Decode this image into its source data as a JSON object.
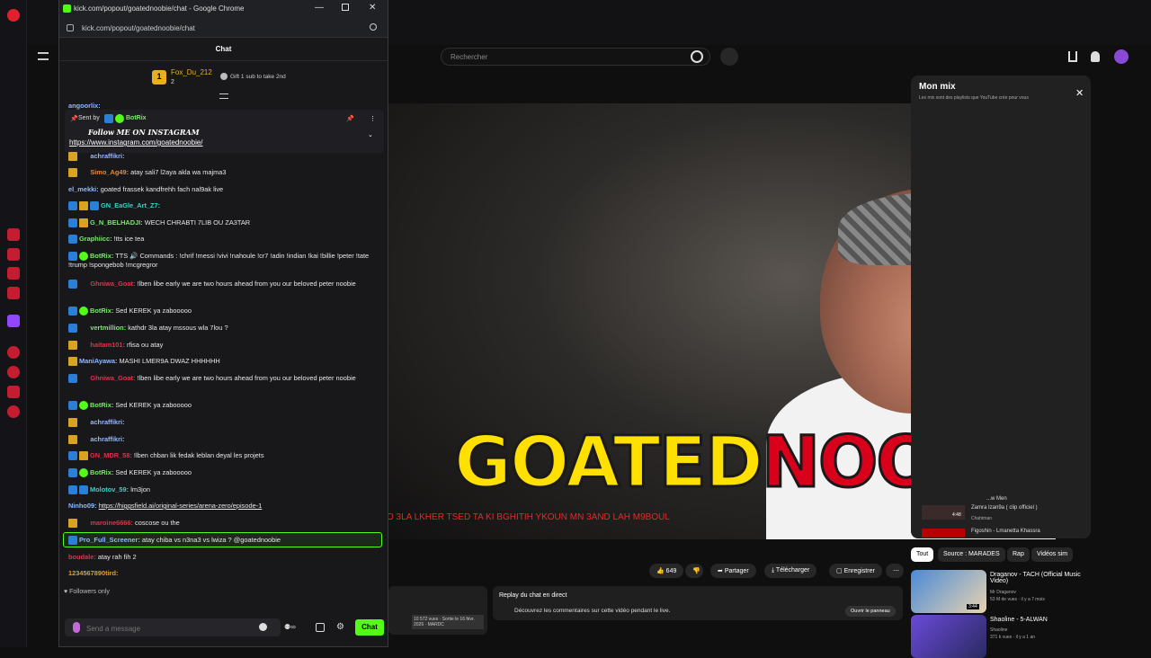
{
  "browser": {
    "popout_title": "kick.com/popout/goatednoobie/chat - Google Chrome",
    "popout_url": "kick.com/popout/goatednoobie/chat"
  },
  "youtube": {
    "search_placeholder": "Rechercher",
    "video_ticker": "O 3LA LKHER TSED TA KI BGHITIH YKOUN MN 3AND LAH M9BOUL",
    "logo_part1": "GOATED",
    "logo_part2": "NOOBIE",
    "mix": {
      "title": "Mon mix",
      "subtitle": "Les mix sont des playlists que YouTube crée pour vous",
      "items": [
        {
          "title": "...w Men",
          "channel": ""
        },
        {
          "title": "Zamra Izan9a ( clip officiel )",
          "channel": "Chahtman",
          "duration": "4:48"
        },
        {
          "title": "Figoshin - Lmanetta Khassra",
          "channel": ""
        }
      ]
    },
    "chips": [
      "Tout",
      "Source : MARADES",
      "Rap",
      "Vidéos sim"
    ],
    "actions": {
      "likes": "649",
      "share": "Partager",
      "download": "Télécharger",
      "save": "Enregistrer"
    },
    "live_chat": {
      "title": "Replay du chat en direct",
      "desc": "Découvrez les commentaires sur cette vidéo pendant le live.",
      "button": "Ouvrir le panneau"
    },
    "views_box": "10 572 vues · Sortie le 16 févr. 2026 · MARDC",
    "recs": [
      {
        "title": "Draganov - TACH (Official Music Video)",
        "channel": "Mr Draganov",
        "meta": "53 M de vues · il y a 7 mois",
        "duration": "3:44"
      },
      {
        "title": "Shaoline - 5-ALWAN",
        "channel": "Shaoline",
        "meta": "371 k vues · il y a 1 an"
      }
    ]
  },
  "chat": {
    "header": "Chat",
    "sub_leader": {
      "name": "Fox_Du_212",
      "rank": "1",
      "count": "2",
      "gift_text": "Gift 1 sub to take 2nd"
    },
    "partial_top_user": "angoorlix:",
    "pinned": {
      "sent_by": "Sent by",
      "author": "BotRix",
      "line1": "Follow ME ON INSTAGRAM",
      "link": "https://www.instagram.com/goatednoobie/"
    },
    "messages": [
      {
        "user": "achraffikri:",
        "text": "",
        "color": "#8fb8ff"
      },
      {
        "user": "Simo_Ag49:",
        "text": "atay sali7 l2aya akla wa majma3",
        "color": "#e08a3c"
      },
      {
        "user": "el_mekki:",
        "text": "goated frassek kandfrehh fach nal9ak live",
        "color": "#8fb8ff"
      },
      {
        "user": "GN_EaGle_Art_Z7:",
        "text": "",
        "color": "#3cd0c8"
      },
      {
        "user": "G_N_BELHADJI:",
        "text": "WECH CHRABTI 7LIB OU ZA3TAR",
        "color": "#7be86c"
      },
      {
        "user": "Graphiicc:",
        "text": "!tts ice tea",
        "color": "#7be86c"
      },
      {
        "user": "BotRix:",
        "text": "TTS 🔊 Commands : !chrif !messi !vivi !nahoule !cr7 !adin !indian !kai !billie !peter !tate !trump !spongebob !mcgregror",
        "color": "#7be86c"
      },
      {
        "user": "Ghniwa_Goat:",
        "text": "!lben libe early we are two hours ahead from you our beloved peter noobie",
        "color": "#d8354a"
      },
      {
        "user": "BotRix:",
        "text": "Sed KEREK ya zabooooo",
        "color": "#7be86c"
      },
      {
        "user": "vertmillion:",
        "text": "kathdr 3la atay mssous wla 7lou ?",
        "color": "#7be86c"
      },
      {
        "user": "haitam101:",
        "text": "rfisa ou atay",
        "color": "#d8354a"
      },
      {
        "user": "ManiAyawa:",
        "text": "MASHI LMER9A DWAZ HHHHHH",
        "color": "#8fb8ff"
      },
      {
        "user": "Ghniwa_Goat:",
        "text": "!lben libe early we are two hours ahead from you our beloved peter noobie",
        "color": "#d8354a"
      },
      {
        "user": "BotRix:",
        "text": "Sed KEREK ya zabooooo",
        "color": "#7be86c"
      },
      {
        "user": "achraffikri:",
        "text": "",
        "color": "#8fb8ff"
      },
      {
        "user": "achraffikri:",
        "text": "",
        "color": "#8fb8ff"
      },
      {
        "user": "GN_MDR_58:",
        "text": "!lben chban lik fedak leblan deyal les projets",
        "color": "#d8354a"
      },
      {
        "user": "BotRix:",
        "text": "Sed KEREK ya zabooooo",
        "color": "#7be86c"
      },
      {
        "user": "Molotov_59:",
        "text": "lm3jon",
        "color": "#3cd0c8"
      },
      {
        "user": "Ninho09:",
        "text": "https://higgsfield.ai/original-series/arena-zero/episode-1",
        "color": "#8fb8ff"
      },
      {
        "user": "maroine6666:",
        "text": "coscose ou the",
        "color": "#d8354a"
      },
      {
        "user": "Pro_Full_Screener:",
        "text": "atay chiba vs n3na3 vs lwiza ? @goatednoobie",
        "color": "#8fb8ff"
      },
      {
        "user": "boudale:",
        "text": "atay rah fih 2",
        "color": "#d8354a"
      },
      {
        "user": "1234567890tird:",
        "text": "",
        "color": "#e0a020"
      }
    ],
    "followers_only": "Followers only",
    "composer_placeholder": "Send a message",
    "send_label": "Chat"
  }
}
